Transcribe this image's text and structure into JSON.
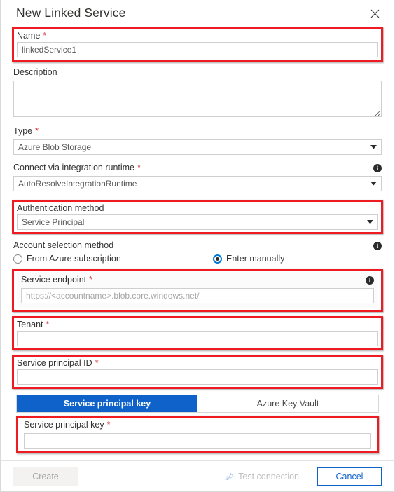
{
  "dialog": {
    "title": "New Linked Service",
    "close_label": "×"
  },
  "fields": {
    "name": {
      "label": "Name",
      "required": "*",
      "value": "linkedService1",
      "placeholder": ""
    },
    "description": {
      "label": "Description",
      "value": "",
      "placeholder": ""
    },
    "type": {
      "label": "Type",
      "required": "*",
      "value": "Azure Blob Storage"
    },
    "integration_runtime": {
      "label": "Connect via integration runtime",
      "required": "*",
      "value": "AutoResolveIntegrationRuntime",
      "info": "i"
    },
    "auth_method": {
      "label": "Authentication method",
      "value": "Service Principal"
    },
    "account_selection": {
      "label": "Account selection method",
      "info": "i",
      "options": [
        {
          "label": "From Azure subscription",
          "selected": false
        },
        {
          "label": "Enter manually",
          "selected": true
        }
      ]
    },
    "service_endpoint": {
      "label": "Service endpoint",
      "required": "*",
      "info": "i",
      "value": "",
      "placeholder": "https://<accountname>.blob.core.windows.net/"
    },
    "tenant": {
      "label": "Tenant",
      "required": "*",
      "value": "",
      "placeholder": ""
    },
    "service_principal_id": {
      "label": "Service principal ID",
      "required": "*",
      "value": "",
      "placeholder": ""
    },
    "service_principal_key": {
      "label": "Service principal key",
      "required": "*",
      "value": "",
      "placeholder": ""
    }
  },
  "credential_toggle": {
    "options": [
      {
        "label": "Service principal key",
        "active": true
      },
      {
        "label": "Azure Key Vault",
        "active": false
      }
    ]
  },
  "footer": {
    "create_label": "Create",
    "test_connection_label": "Test connection",
    "cancel_label": "Cancel"
  },
  "colors": {
    "accent_blue": "#0f62c9",
    "link_blue": "#1064cc",
    "radio_blue": "#0078d4",
    "required_red": "#d13438",
    "highlight_red": "#ee1b22",
    "disabled_gray": "#a8a6a4"
  }
}
